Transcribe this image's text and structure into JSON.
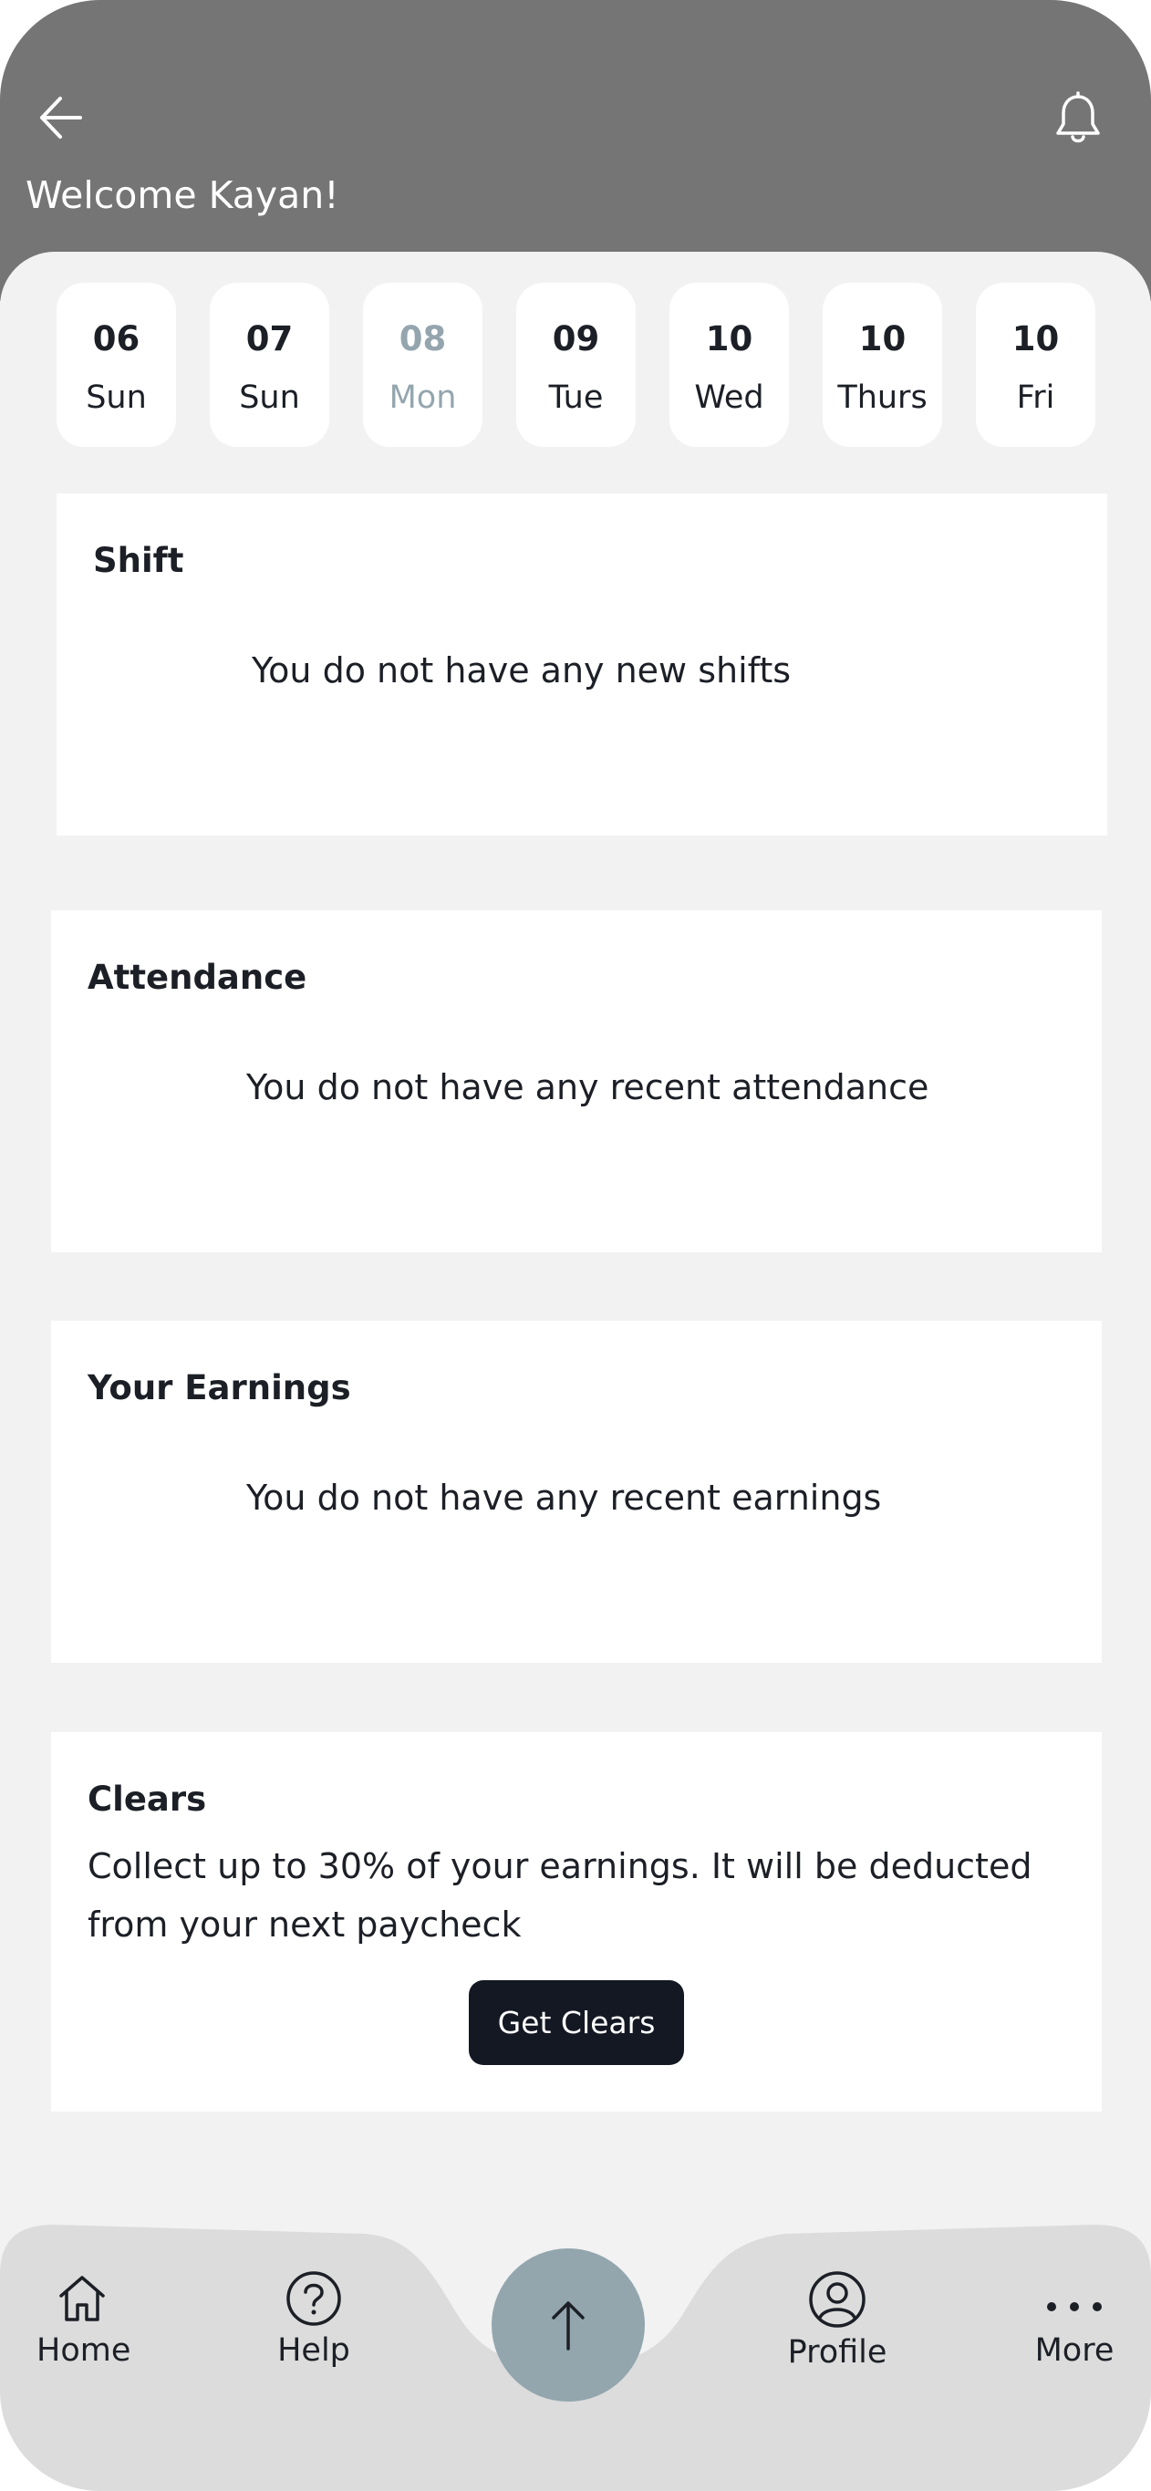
{
  "header": {
    "welcome": "Welcome Kayan!",
    "back_icon": "arrow-left-icon",
    "bell_icon": "bell-icon",
    "color": "#757575"
  },
  "dates": [
    {
      "num": "06",
      "day": "Sun",
      "selected": false
    },
    {
      "num": "07",
      "day": "Sun",
      "selected": false
    },
    {
      "num": "08",
      "day": "Mon",
      "selected": true
    },
    {
      "num": "09",
      "day": "Tue",
      "selected": false
    },
    {
      "num": "10",
      "day": "Wed",
      "selected": false
    },
    {
      "num": "10",
      "day": "Thurs",
      "selected": false
    },
    {
      "num": "10",
      "day": "Fri",
      "selected": false
    }
  ],
  "shift": {
    "title": "Shift",
    "empty": "You do not have any new shifts"
  },
  "attendance": {
    "title": "Attendance",
    "empty": "You do not have any recent attendance"
  },
  "earnings": {
    "title": "Your Earnings",
    "empty": "You do not have any recent earnings"
  },
  "clears": {
    "title": "Clears",
    "description": "Collect up to 30% of your earnings. It will be deducted from your next paycheck",
    "button": "Get Clears"
  },
  "nav": {
    "home": "Home",
    "help": "Help",
    "profile": "Profile",
    "more": "More",
    "fab_icon": "arrow-up-icon"
  },
  "colors": {
    "dark": "#1c1f26",
    "button": "#141823",
    "fab": "#93a6ae",
    "dim_text": "#94a5ae",
    "nav_bg": "#dcdcdc"
  }
}
